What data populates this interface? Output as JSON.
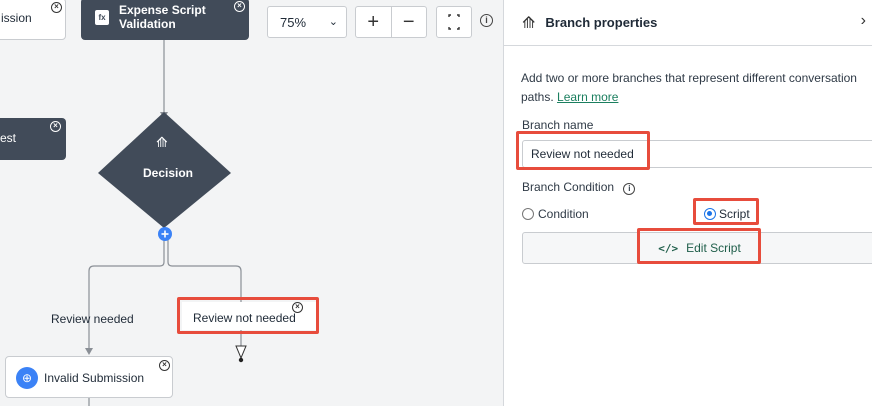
{
  "canvas": {
    "zoom": {
      "value": "75%",
      "options": [
        "75%"
      ]
    },
    "nodes": {
      "submission_partial": "ission",
      "expense_script": {
        "line1": "Expense Script",
        "line2": "Validation"
      },
      "request_partial": "est",
      "decision": "Decision",
      "invalid_submission": "Invalid Submission"
    },
    "edges": {
      "left_label": "Review needed",
      "right_label": "Review not needed"
    },
    "colors": {
      "dark_node": "#414b59",
      "highlight": "#e74c3c",
      "add_node": "#3b82f6"
    }
  },
  "panel": {
    "title": "Branch properties",
    "description": "Add two or more branches that represent different conversation paths.",
    "learn_more": "Learn more",
    "branch_name_label": "Branch name",
    "branch_name_value": "Review not needed",
    "branch_condition_label": "Branch Condition",
    "option_condition": "Condition",
    "option_script": "Script",
    "selected_option": "Script",
    "edit_script_label": "Edit Script"
  }
}
